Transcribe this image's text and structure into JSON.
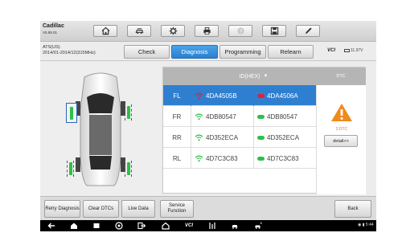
{
  "header": {
    "vehicle": "Cadillac",
    "sub": "V5.95.01",
    "toolbar_icons": [
      "home-icon",
      "car-manager-icon",
      "settings-icon",
      "print-icon",
      "help-icon",
      "save-icon",
      "edit-icon"
    ]
  },
  "info": {
    "line1": "ATS(US)",
    "line2": "2014/01-2014/12(315MHz)",
    "vci_label": "VCI",
    "battery": "11.97V"
  },
  "tabs": [
    {
      "label": "Check",
      "active": false
    },
    {
      "label": "Diagnosis",
      "active": true
    },
    {
      "label": "Programming",
      "active": false
    },
    {
      "label": "Relearn",
      "active": false
    }
  ],
  "table": {
    "id_header": "ID(HEX)",
    "dtc_header": "DTC",
    "rows": [
      {
        "pos": "FL",
        "id1": "4DA4505B",
        "id2": "4DA4506A",
        "status": "fault",
        "selected": true
      },
      {
        "pos": "FR",
        "id1": "4DB80547",
        "id2": "4DB80547",
        "status": "ok",
        "selected": false
      },
      {
        "pos": "RR",
        "id1": "4D352ECA",
        "id2": "4D352ECA",
        "status": "ok",
        "selected": false
      },
      {
        "pos": "RL",
        "id1": "4D7C3C83",
        "id2": "4D7C3C83",
        "status": "ok",
        "selected": false
      }
    ],
    "dtc_count": "3 DTC",
    "detail_label": "detail>>"
  },
  "bottom": {
    "retry": "Retry Diagnosis",
    "clear": "Clear DTCs",
    "live": "Live Data",
    "service": "Service Function",
    "back": "Back"
  },
  "navbar": {
    "time": "5:44"
  },
  "colors": {
    "accent": "#2f7fd0",
    "ok_green": "#2fbf4a",
    "fault_red": "#e0203a",
    "warning": "#f08a1c"
  }
}
